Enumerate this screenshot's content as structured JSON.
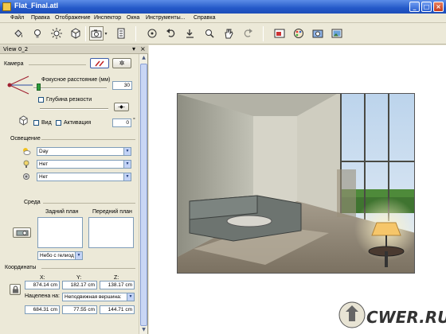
{
  "window": {
    "title": "Flat_Final.atl"
  },
  "menu": [
    "Файл",
    "Правка",
    "Отображение",
    "Инспектор",
    "Окна",
    "Инструменты...",
    "Справка"
  ],
  "toolbar": {
    "tools": [
      "paint-bucket-icon",
      "light-bulb-icon",
      "sun-icon",
      "cube-icon",
      "camera-icon",
      "dropdown-icon",
      "page-icon",
      "orbit-icon",
      "undo-icon",
      "import-icon",
      "zoom-icon",
      "pan-hand-icon",
      "redo-icon",
      "render-window-icon",
      "palette-icon",
      "camera-render-icon",
      "picture-icon"
    ]
  },
  "panel": {
    "title": "View 0_2",
    "camera": {
      "heading": "Камера",
      "focal_label": "Фокусное расстояние (мм)",
      "focal_value": "30",
      "dof_label": "Глубина резкости",
      "view_label": "Вид",
      "activate_label": "Активация",
      "angle_value": "0",
      "degree_sign": "°"
    },
    "lighting": {
      "heading": "Освещение",
      "sky_value": "Day",
      "light2_value": "Нет",
      "light3_value": "Нет"
    },
    "environment": {
      "heading": "Среда",
      "background_label": "Задний план",
      "foreground_label": "Передний план",
      "background_combo": "Небо с гелиод"
    },
    "coordinates": {
      "heading": "Координаты",
      "x_label": "X:",
      "y_label": "Y:",
      "z_label": "Z:",
      "x_value": "874.14 cm",
      "y_value": "182.17 cm",
      "z_value": "138.17 cm",
      "aim_label": "Нацелена на:",
      "aim_target": "Неподвижная вершина:",
      "tx_value": "684.31 cm",
      "ty_value": "77.55 cm",
      "tz_value": "144.71 cm"
    }
  },
  "watermark": {
    "text": "CWER.RU"
  },
  "colors": {
    "titlebar": "#2459c8",
    "sky": "#9ec0e0",
    "grass": "#4e8a3a",
    "lamp": "#f6c66a"
  }
}
